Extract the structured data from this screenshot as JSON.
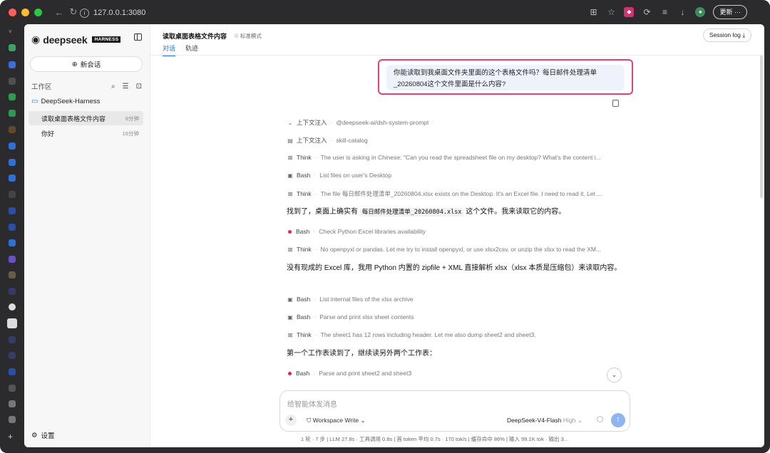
{
  "browser": {
    "url": "127.0.0.1:3080",
    "update_label": "更新",
    "update_more": "···",
    "colors": {
      "close": "#ff5f57",
      "minimize": "#febc2e",
      "zoom": "#28c840"
    }
  },
  "sidebar": {
    "logo_name": "deepseek",
    "logo_badge": "HARNESS",
    "new_chat": "新会话",
    "workspace_label": "工作区",
    "project_name": "DeepSeek-Harness",
    "conversations": [
      {
        "title": "读取桌面表格文件内容",
        "time": "6分钟",
        "active": true
      },
      {
        "title": "你好",
        "time": "16分钟",
        "active": false
      }
    ],
    "settings_label": "设置"
  },
  "header": {
    "title": "读取桌面表格文件内容",
    "mode": "标准模式",
    "tabs": [
      {
        "label": "对话",
        "active": true
      },
      {
        "label": "轨迹",
        "active": false
      }
    ],
    "session_log": "Session log"
  },
  "chat": {
    "user_message": "你能读取到我桌面文件夹里面的这个表格文件吗？每日邮件处理清单_20260804这个文件里面是什么内容?",
    "steps": [
      {
        "icon": "chevron-down-icon",
        "kind": "上下文注入",
        "desc": "@deepseek-ai/dsh-system-prompt"
      },
      {
        "icon": "document-icon",
        "kind": "上下文注入",
        "desc": "skill-catalog"
      },
      {
        "icon": "think-icon",
        "kind": "Think",
        "desc": "The user is asking in Chinese: \"Can you read the spreadsheet file on my desktop? What's the content i..."
      },
      {
        "icon": "terminal-icon",
        "kind": "Bash",
        "desc": "List files on user's Desktop"
      },
      {
        "icon": "think-icon",
        "kind": "Think",
        "desc": "The file 每日邮件处理清单_20260804.xlsx exists on the Desktop. It's an Excel file. I need to read it. Let ..."
      },
      {
        "icon": "red-dot",
        "kind": "Bash",
        "desc": "Check Python Excel libraries availability"
      },
      {
        "icon": "think-icon",
        "kind": "Think",
        "desc": "No openpyxl or pandas. Let me try to install openpyxl, or use xlsx2csv, or unzip the xlsx to read the XM..."
      },
      {
        "icon": "terminal-icon",
        "kind": "Bash",
        "desc": "List internal files of the xlsx archive"
      },
      {
        "icon": "terminal-icon",
        "kind": "Bash",
        "desc": "Parse and print xlsx sheet contents"
      },
      {
        "icon": "think-icon",
        "kind": "Think",
        "desc": "The sheet1 has 12 rows including header. Let me also dump sheet2 and sheet3."
      },
      {
        "icon": "red-dot",
        "kind": "Bash",
        "desc": "Parse and print sheet2 and sheet3"
      }
    ],
    "para1_before": "找到了，桌面上确实有 ",
    "para1_code": "每日邮件处理清单_20260804.xlsx",
    "para1_after": " 这个文件。我来读取它的内容。",
    "para2": "没有现成的 Excel 库，我用 Python 内置的 zipfile + XML 直接解析 xlsx（xlsx 本质是压缩包）来读取内容。",
    "para3": "第一个工作表读到了，继续读另外两个工作表："
  },
  "composer": {
    "placeholder": "给智能体发消息",
    "permission": "Workspace Write",
    "model": "DeepSeek-V4-Flash",
    "level": "High"
  },
  "status_bar": "1 轮 · 7 步  |  LLM 27.8s · 工具调用 0.8s  |  首 token 平均 0.7s · 170 tok/s  |  缓存命中 86%  |  输入 99.1K tok · 输出 3..."
}
